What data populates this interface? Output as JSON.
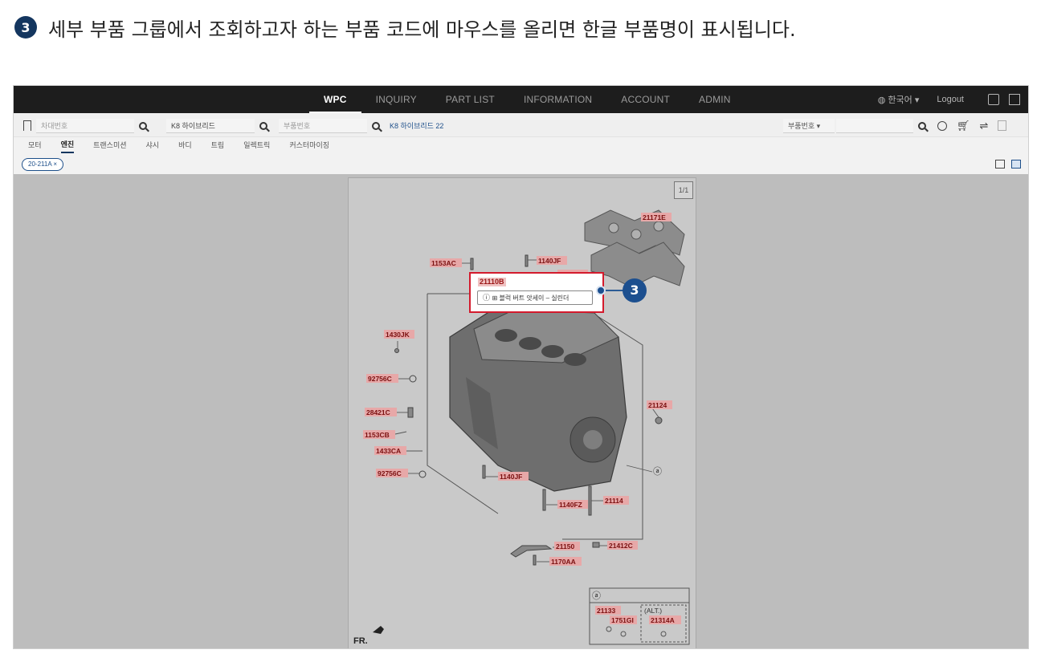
{
  "instruction": {
    "step": "3",
    "text": "세부 부품 그룹에서 조회하고자 하는 부품 코드에 마우스를 올리면 한글 부품명이 표시됩니다."
  },
  "topnav": {
    "items": [
      "WPC",
      "INQUIRY",
      "PART LIST",
      "INFORMATION",
      "ACCOUNT",
      "ADMIN"
    ],
    "active": "WPC",
    "language": "한국어",
    "logout": "Logout"
  },
  "search": {
    "vin_placeholder": "차대번호",
    "model_value": "K8 하이브리드",
    "part_placeholder": "부품번호",
    "breadcrumb": "K8 하이브리드 22",
    "part_type_select": "부품번호"
  },
  "categories": [
    "모터",
    "엔진",
    "트랜스미션",
    "샤시",
    "바디",
    "트림",
    "일렉트릭",
    "커스터마이징"
  ],
  "active_category": "엔진",
  "chip": "20-211A ×",
  "page_indicator": "1/1",
  "tooltip": {
    "part_code": "21110B",
    "text": "블럭 버트 앗세이 – 실린더"
  },
  "callout": "3",
  "diagram_labels": {
    "l21171E": "21171E",
    "l1153AC": "1153AC",
    "l1140JF_top": "1140JF",
    "l1571TA": "1571TA",
    "l1430JK": "1430JK",
    "l92756C_a": "92756C",
    "l28421C": "28421C",
    "l1153CB": "1153CB",
    "l1433CA": "1433CA",
    "l92756C_b": "92756C",
    "l1140JF_bot": "1140JF",
    "l21124": "21124",
    "l1140FZ": "1140FZ",
    "l21114": "21114",
    "l21150": "21150",
    "l21412C": "21412C",
    "l1170AA": "1170AA",
    "l21133": "21133",
    "l1751GI": "1751GI",
    "lALT": "(ALT.)",
    "l21314A": "21314A",
    "ref_a1": "ⓐ",
    "ref_a2": "ⓐ",
    "fr": "FR."
  }
}
